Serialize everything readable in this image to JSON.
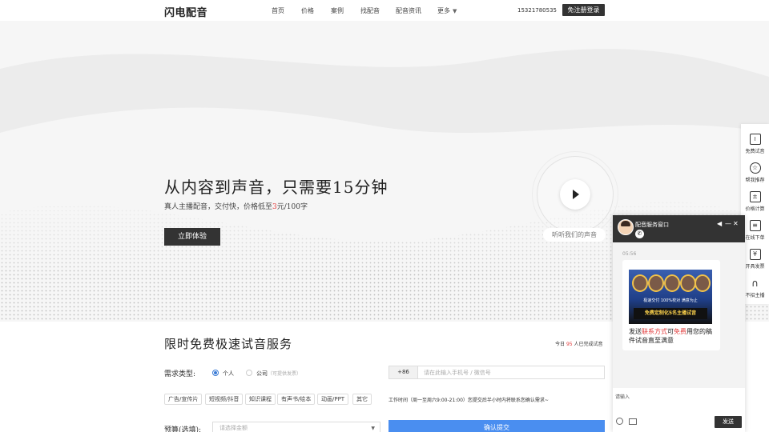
{
  "nav": {
    "logo": "闪电配音",
    "links": [
      "首页",
      "价格",
      "案例",
      "找配音",
      "配音资讯",
      "更多"
    ],
    "phone": "15321780535",
    "login_label": "免注册登录"
  },
  "hero": {
    "title": "从内容到声音，只需要15分钟",
    "subtitle_before": "真人主播配音，交付快，价格低至",
    "subtitle_price": "3",
    "subtitle_after": "元/100字",
    "try_label": "立即体验",
    "listen_label": "听听我们的声音"
  },
  "form": {
    "title": "限时免费极速试音服务",
    "count_prefix": "今日",
    "count_value": "95",
    "count_suffix": "人已完成试音",
    "demand_label": "需求类型:",
    "radio_personal": "个人",
    "radio_company": "公司",
    "radio_company_hint": "（可提供发票）",
    "tags": [
      "广告/宣传片",
      "短视频/抖音",
      "知识课程",
      "有声书/绘本",
      "动画/PPT",
      "其它"
    ],
    "country_code": "+86",
    "phone_placeholder": "请在此输入手机号 / 微信号",
    "worktime": "工作时间（周一至周六9:00-21:00）您提交后半小时内将联系您确认需求~",
    "budget_label": "预算(选填):",
    "budget_placeholder": "请选择金额",
    "submit_label": "确认提交"
  },
  "sidebar": {
    "items": [
      {
        "label": "免费试音",
        "icon": "audio-wave-icon"
      },
      {
        "label": "帮我推荐",
        "icon": "user-star-icon"
      },
      {
        "label": "价格计算",
        "icon": "calculator-icon"
      },
      {
        "label": "在线下单",
        "icon": "order-form-icon"
      },
      {
        "label": "开具发票",
        "icon": "invoice-icon"
      },
      {
        "label": "不招主播",
        "icon": "headphones-icon"
      }
    ]
  },
  "chat": {
    "title": "配音服务窗口",
    "time": "05:56",
    "ad_line": "极速交付   100%校对   满意为止",
    "ad_bar": "免费定制化5名主播试音",
    "msg_1": "发送",
    "msg_contact": "联系方式",
    "msg_2": "可",
    "msg_free": "免费",
    "msg_3": "用您的稿件试音直至满意",
    "input_placeholder": "请输入",
    "send_label": "发送"
  }
}
